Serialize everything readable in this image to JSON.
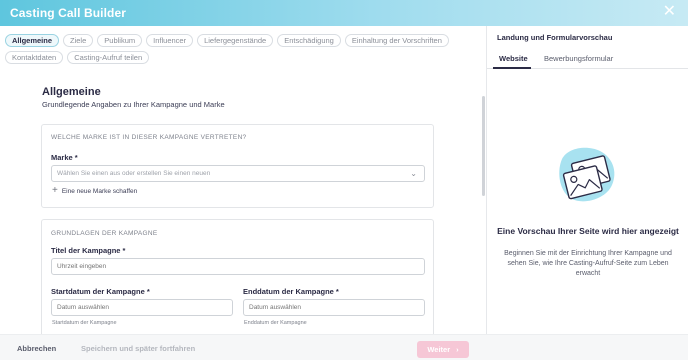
{
  "header": {
    "title": "Casting Call Builder",
    "close_icon": "close-icon"
  },
  "tabs": [
    {
      "label": "Allgemeine",
      "active": true
    },
    {
      "label": "Ziele"
    },
    {
      "label": "Publikum"
    },
    {
      "label": "Influencer"
    },
    {
      "label": "Liefergegenstände"
    },
    {
      "label": "Entschädigung"
    },
    {
      "label": "Einhaltung der Vorschriften"
    },
    {
      "label": "Kontaktdaten"
    },
    {
      "label": "Casting-Aufruf teilen"
    }
  ],
  "main": {
    "title": "Allgemeine",
    "subtitle": "Grundlegende Angaben zu Ihrer Kampagne und Marke",
    "brand_card": {
      "caption": "WELCHE MARKE IST IN DIESER KAMPAGNE VERTRETEN?",
      "label": "Marke *",
      "placeholder": "Wählen Sie einen aus oder erstellen Sie einen neuen",
      "add_link": "Eine neue Marke schaffen"
    },
    "basics_card": {
      "caption": "GRUNDLAGEN DER KAMPAGNE",
      "title_label": "Titel der Kampagne *",
      "title_placeholder": "Uhrzeit eingeben",
      "start_label": "Startdatum der Kampagne *",
      "start_placeholder": "Datum auswählen",
      "start_help": "Startdatum der Kampagne",
      "end_label": "Enddatum der Kampagne *",
      "end_placeholder": "Datum auswählen",
      "end_help": "Enddatum der Kampagne"
    }
  },
  "footer": {
    "cancel_label": "Abbrechen",
    "save_label": "Speichern und später fortfahren",
    "next_label": "Weiter"
  },
  "preview": {
    "title": "Landung und Formularvorschau",
    "tabs": [
      {
        "label": "Website",
        "active": true
      },
      {
        "label": "Bewerbungsformular"
      }
    ],
    "empty_title": "Eine Vorschau Ihrer Seite wird hier angezeigt",
    "empty_text": "Beginnen Sie mit der Einrichtung Ihrer Kampagne und sehen Sie, wie Ihre Casting-Aufruf-Seite zum Leben erwacht"
  },
  "colors": {
    "header_gradient_start": "#5ec6de",
    "header_gradient_end": "#c7eaf4",
    "next_button": "#f6c7d6",
    "illustration_blob": "#a8e2f0",
    "text_dark": "#2b2b45"
  }
}
